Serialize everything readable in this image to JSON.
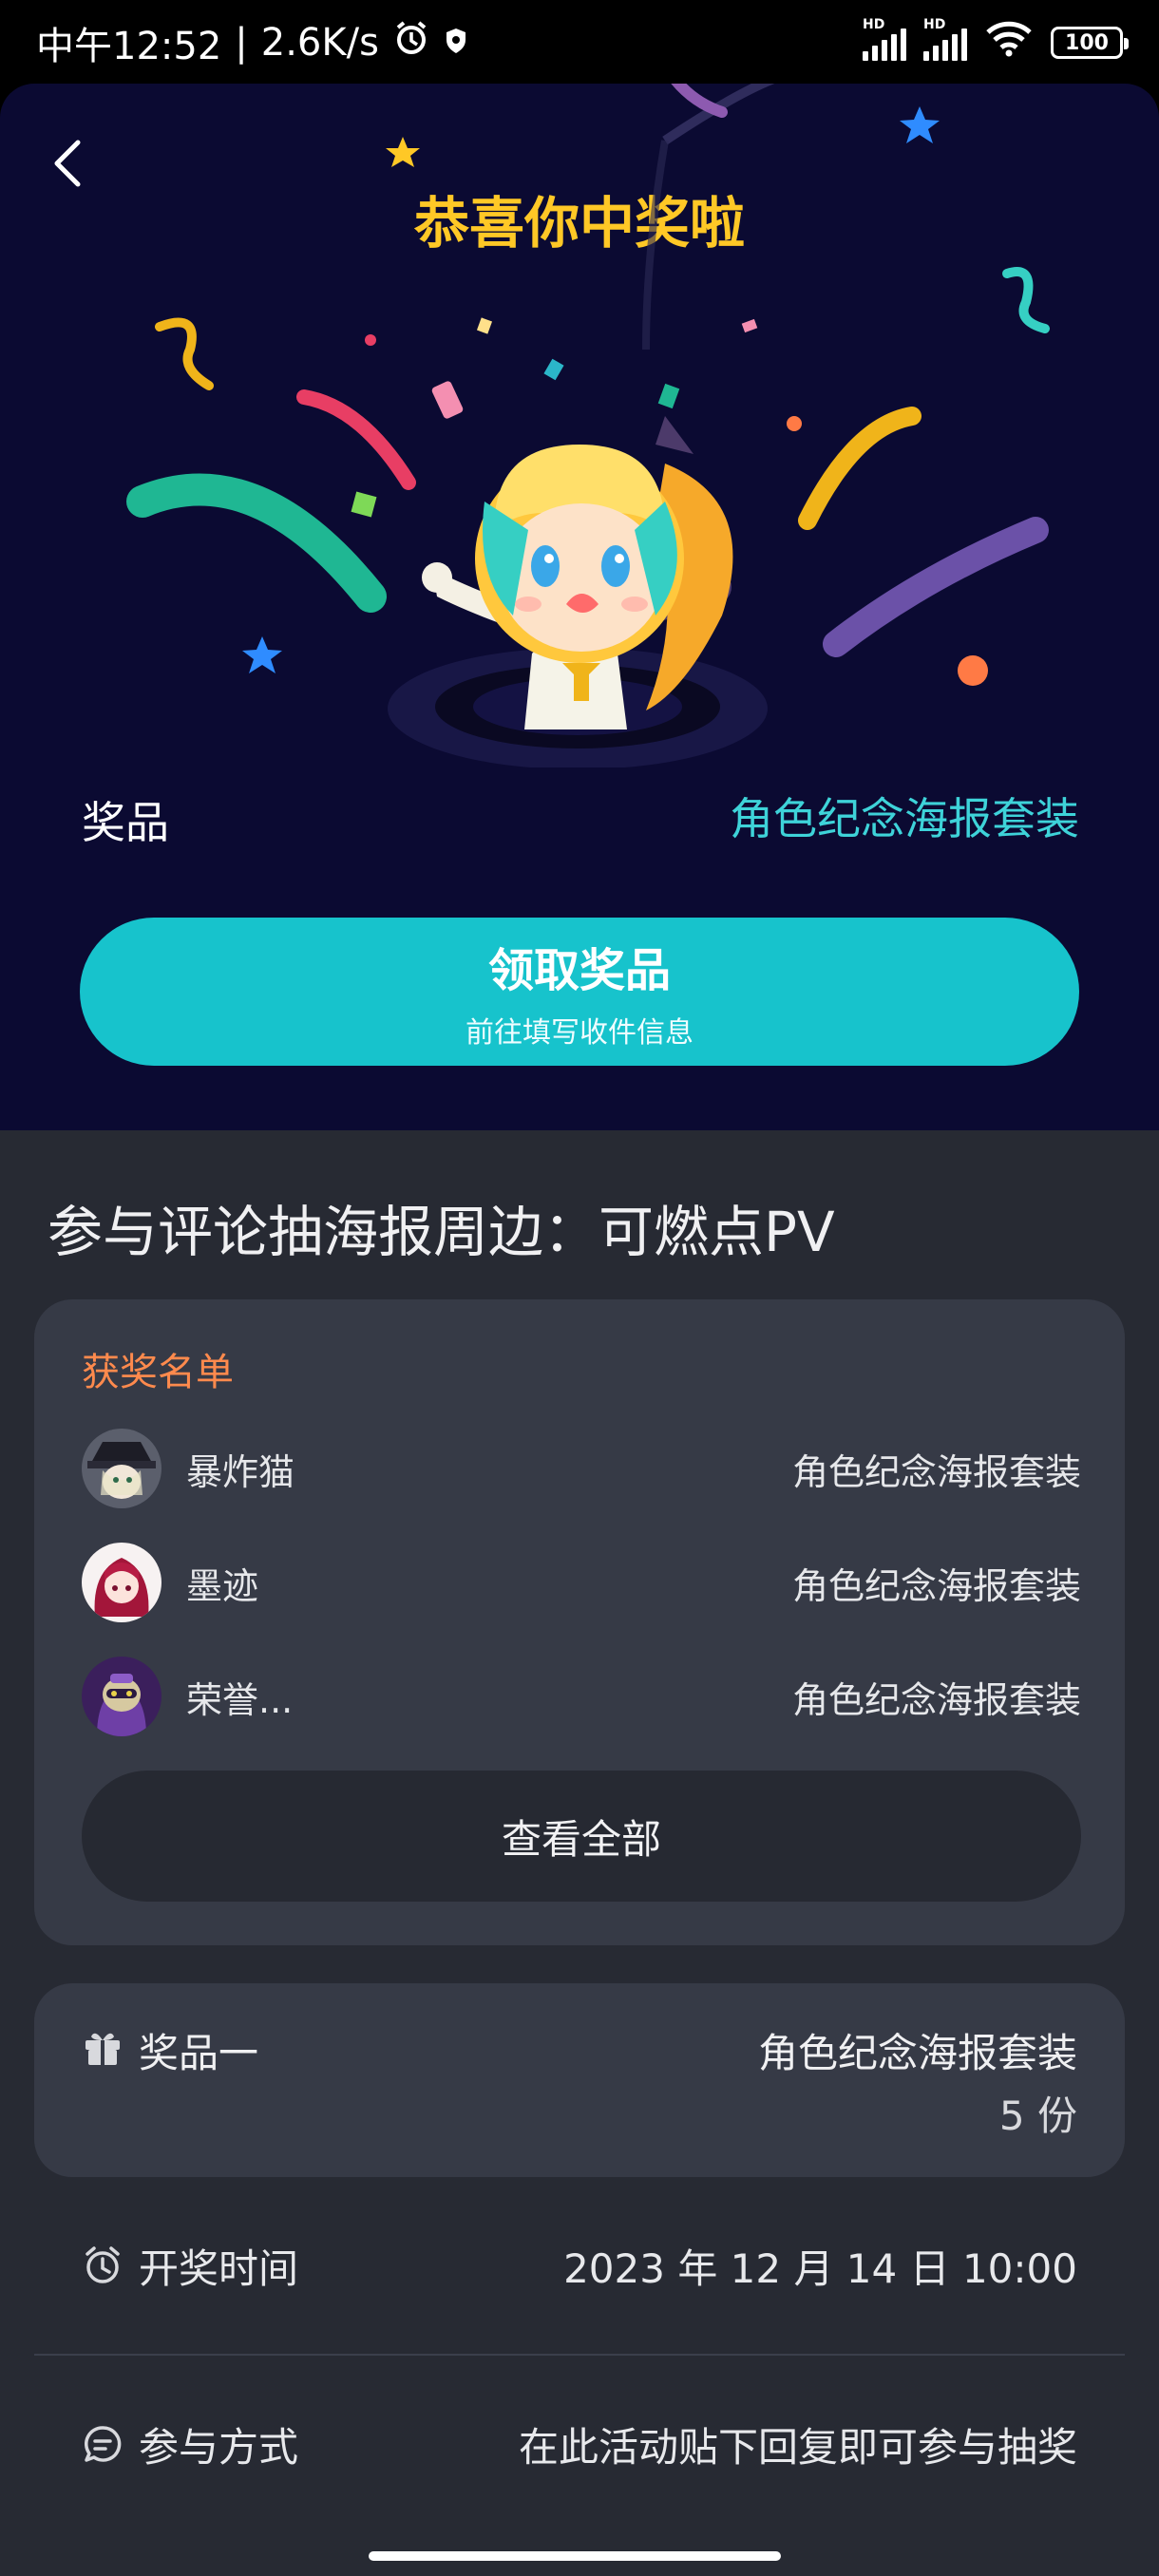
{
  "status_bar": {
    "time": "中午12:52",
    "separator": "|",
    "net_speed": "2.6K/s",
    "hd1": "HD",
    "hd2": "HD",
    "battery": "100"
  },
  "hero": {
    "title": "恭喜你中奖啦",
    "prize_label": "奖品",
    "prize_value": "角色纪念海报套装",
    "claim_button": {
      "label": "领取奖品",
      "sublabel": "前往填写收件信息"
    }
  },
  "event": {
    "title": "参与评论抽海报周边：可燃点PV"
  },
  "winners": {
    "title": "获奖名单",
    "items": [
      {
        "name": "暴炸猫",
        "prize": "角色纪念海报套装"
      },
      {
        "name": "墨迹",
        "prize": "角色纪念海报套装"
      },
      {
        "name": "荣誉...",
        "prize": "角色纪念海报套装"
      }
    ],
    "view_all": "查看全部"
  },
  "prize": {
    "label": "奖品一",
    "name": "角色纪念海报套装",
    "count": "5 份"
  },
  "draw_time": {
    "label": "开奖时间",
    "value": "2023 年 12 月 14 日 10:00"
  },
  "participation": {
    "label": "参与方式",
    "value": "在此活动贴下回复即可参与抽奖"
  },
  "colors": {
    "hero_bg": "#0b0a32",
    "title": "#ffc826",
    "accent": "#17c3cc",
    "prize_text": "#3ed3d9",
    "winners_title": "#ff8a4d",
    "card": "#363a46",
    "page_bg": "#272a33"
  }
}
